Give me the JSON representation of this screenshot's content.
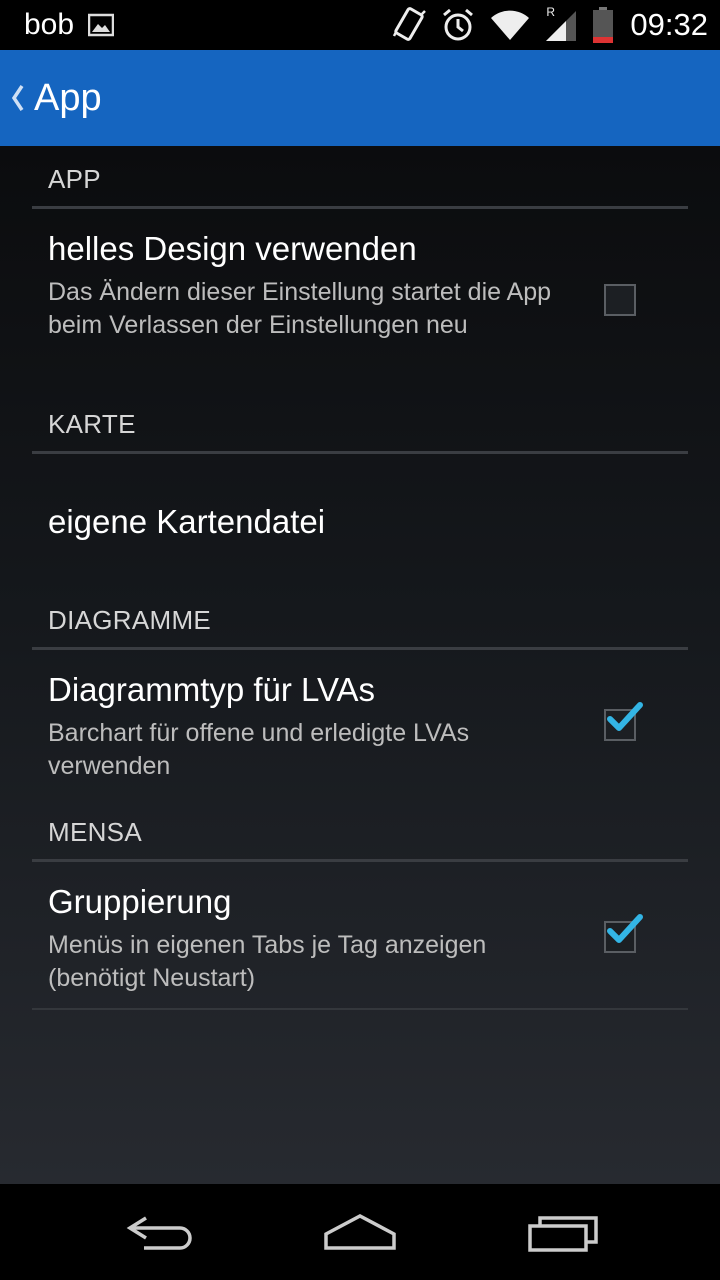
{
  "status_bar": {
    "user": "bob",
    "time": "09:32",
    "icons": [
      "image-icon",
      "vibrate-icon",
      "alarm-icon",
      "wifi-icon",
      "signal-icon",
      "battery-icon"
    ],
    "roaming": "R"
  },
  "action_bar": {
    "title": "App",
    "color": "#1565c0"
  },
  "sections": {
    "app": {
      "header": "APP",
      "item": {
        "title": "helles Design verwenden",
        "summary": "Das Ändern dieser Einstellung startet die App beim Verlassen der Einstellungen neu",
        "checked": false
      }
    },
    "karte": {
      "header": "KARTE",
      "item": {
        "title": "eigene Kartendatei"
      }
    },
    "diagramme": {
      "header": "DIAGRAMME",
      "item": {
        "title": "Diagrammtyp für LVAs",
        "summary": "Barchart für offene und erledigte LVAs verwenden",
        "checked": true
      }
    },
    "mensa": {
      "header": "MENSA",
      "item": {
        "title": "Gruppierung",
        "summary": "Menüs in eigenen Tabs je Tag anzeigen (benötigt Neustart)",
        "checked": true
      }
    }
  },
  "colors": {
    "accent_check": "#33b5e5",
    "action_bar": "#1565c0"
  },
  "nav_bar": {
    "buttons": [
      "back-icon",
      "home-icon",
      "recents-icon"
    ]
  }
}
